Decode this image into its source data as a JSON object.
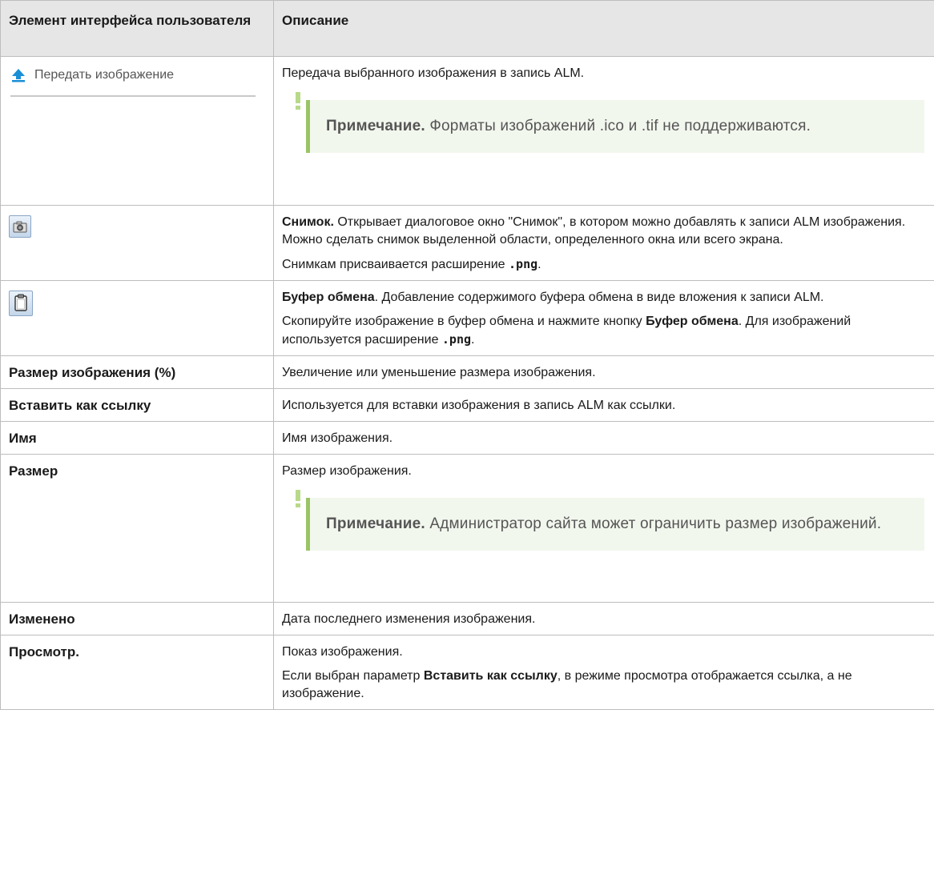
{
  "header": {
    "col1": "Элемент интерфейса пользователя",
    "col2": "Описание"
  },
  "rows": {
    "upload": {
      "button_label": "Передать изображение",
      "desc": "Передача выбранного изображения в запись ALM.",
      "note_bold": "Примечание.",
      "note_text": " Форматы изображений .ico и .tif не поддерживаются."
    },
    "snapshot": {
      "icon": "camera-icon",
      "desc_bold": "Снимок.",
      "desc": " Открывает диалоговое окно \"Снимок\", в котором можно добавлять к записи ALM изображения. Можно сделать снимок выделенной области, определенного окна или всего экрана.",
      "desc2_pre": "Снимкам присваивается расширение ",
      "desc2_code": ".png",
      "desc2_post": "."
    },
    "clipboard": {
      "icon": "clipboard-icon",
      "desc_bold": "Буфер обмена",
      "desc": ". Добавление содержимого буфера обмена в виде вложения к записи ALM.",
      "desc2_pre": "Скопируйте изображение в буфер обмена и нажмите кнопку ",
      "desc2_bold": "Буфер обмена",
      "desc2_mid": ". Для изображений используется расширение ",
      "desc2_code": ".png",
      "desc2_post": "."
    },
    "size_pct": {
      "label": "Размер изображения (%)",
      "desc": "Увеличение или уменьшение размера изображения."
    },
    "insert_link": {
      "label": "Вставить как ссылку",
      "desc": "Используется для вставки изображения в запись ALM как ссылки."
    },
    "name": {
      "label": "Имя",
      "desc": "Имя изображения."
    },
    "size": {
      "label": "Размер",
      "desc": "Размер изображения.",
      "note_bold": "Примечание.",
      "note_text": " Администратор сайта может ограничить размер изображений."
    },
    "modified": {
      "label": "Изменено",
      "desc": "Дата последнего изменения изображения."
    },
    "preview": {
      "label": "Просмотр.",
      "desc": "Показ изображения.",
      "desc2_pre": "Если выбран параметр ",
      "desc2_bold": "Вставить как ссылку",
      "desc2_post": ", в режиме просмотра отображается ссылка, а не изображение."
    }
  },
  "colors": {
    "header_bg": "#e6e6e6",
    "note_bg": "#f2f7ee",
    "note_border": "#9ac465",
    "upload_arrow": "#1a8fd6"
  }
}
